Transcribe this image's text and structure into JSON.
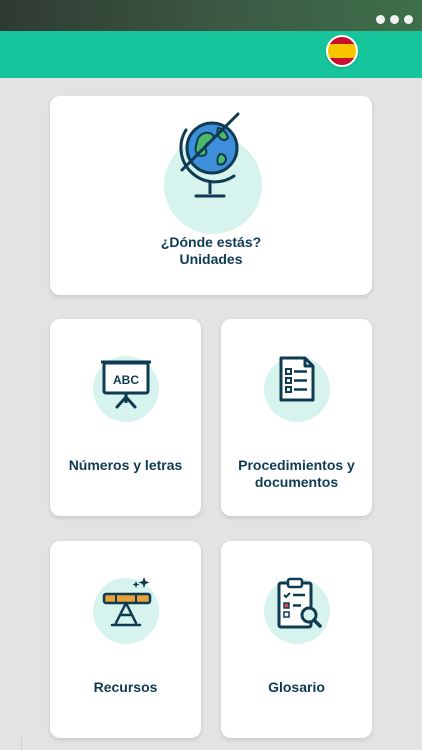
{
  "header": {
    "more_icon": "more-horizontal-icon",
    "language_flag": "spain-flag-icon",
    "colors": {
      "status_bar": "#2f3a33",
      "app_bar": "#17c59d",
      "background": "#e3e3e3",
      "label": "#0f3b52",
      "icon_circle": "#d6f3ee"
    }
  },
  "cards": [
    {
      "icon": "globe-icon",
      "label_line1": "¿Dónde estás?",
      "label_line2": "Unidades"
    },
    {
      "icon": "abc-board-icon",
      "label_line1": "Números y letras",
      "label_line2": ""
    },
    {
      "icon": "document-list-icon",
      "label_line1": "Procedimientos y",
      "label_line2": "documentos"
    },
    {
      "icon": "telescope-icon",
      "label_line1": "Recursos",
      "label_line2": ""
    },
    {
      "icon": "clipboard-search-icon",
      "label_line1": "Glosario",
      "label_line2": ""
    }
  ],
  "abc_text": "ABC"
}
